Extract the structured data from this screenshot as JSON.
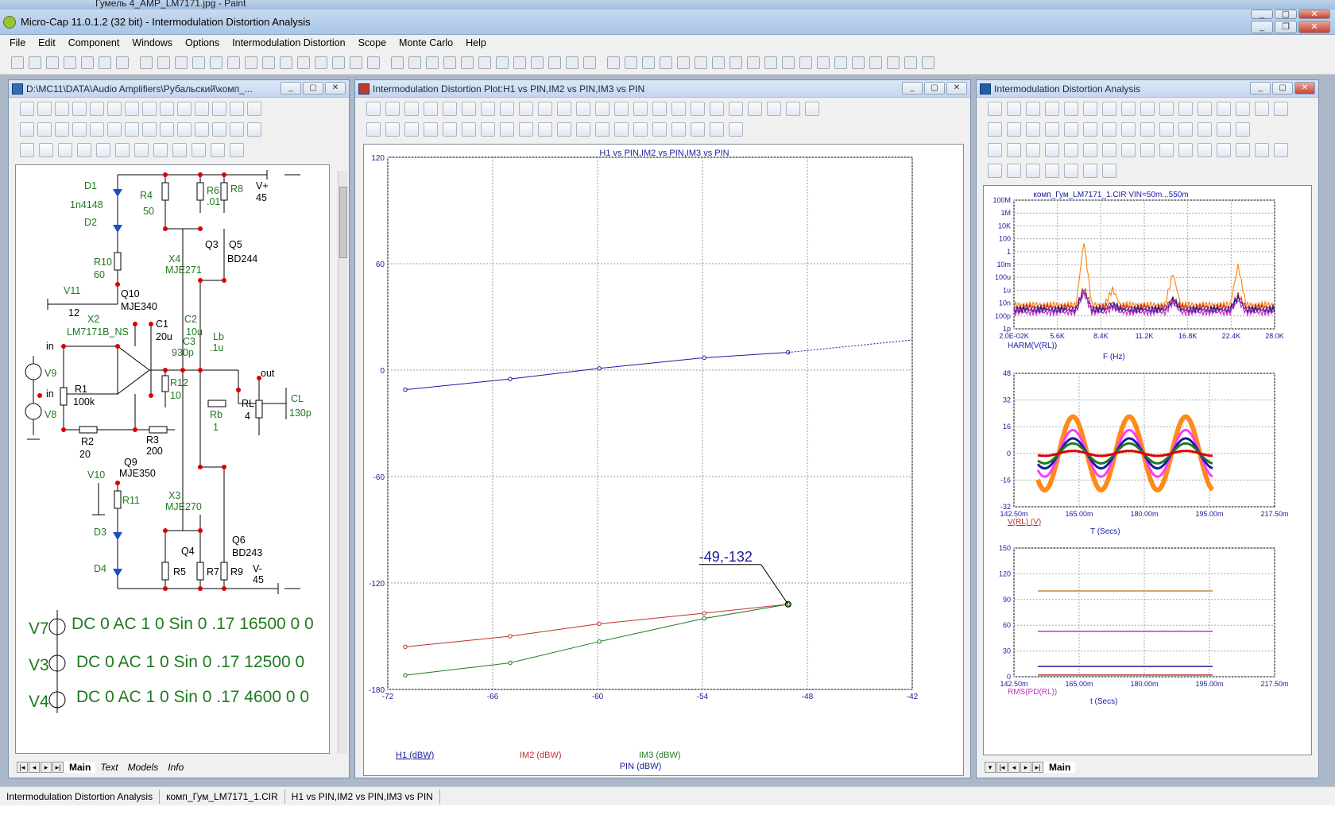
{
  "paint_title": "Гумель 4_AMP_LM7171.jpg - Paint",
  "app_title": "Micro-Cap 11.0.1.2 (32 bit) - Intermodulation Distortion Analysis",
  "menu": [
    "File",
    "Edit",
    "Component",
    "Windows",
    "Options",
    "Intermodulation Distortion",
    "Scope",
    "Monte Carlo",
    "Help"
  ],
  "schematic_window": {
    "title": "D:\\MC11\\DATA\\Audio Amplifiers\\Рубальский\\комп_...",
    "tabs": [
      "Main",
      "Text",
      "Models",
      "Info"
    ],
    "labels": {
      "D1": "D1",
      "n4148": "1n4148",
      "D2": "D2",
      "R4": "R4",
      "R4v": "50",
      "R6": "R6",
      "R6v": ".01",
      "R8": "R8",
      "Vp": "V+",
      "Vpv": "45",
      "R10": "R10",
      "R10v": "60",
      "X4": "X4",
      "X4m": "MJE271",
      "Q3": "Q3",
      "Q5": "Q5",
      "Q5m": "BD244",
      "Q10": "Q10",
      "Q10m": "MJE340",
      "V11": "V11",
      "V11v": "12",
      "X2": "X2",
      "X2m": "LM7171B_NS",
      "C1": "C1",
      "C1v": "20u",
      "C2": "C2",
      "C2v": "10u",
      "C3": "C3",
      "C3v": "930p",
      "Lb": "Lb",
      "Lbv": ".1u",
      "in1": "in",
      "in2": "in",
      "V9": "V9",
      "V8": "V8",
      "R1": "R1",
      "R1v": "100k",
      "R12": "R12",
      "R12v": "10",
      "out": "out",
      "RL": "RL",
      "RLv": "4",
      "Rb": "Rb",
      "Rbv": "1",
      "CL": "CL",
      "CLv": "130p",
      "R2": "R2",
      "R2v": "20",
      "R3": "R3",
      "R3v": "200",
      "Q9": "Q9",
      "Q9m": "MJE350",
      "V10": "V10",
      "R11": "R11",
      "X3": "X3",
      "X3m": "MJE270",
      "D3": "D3",
      "Q6": "Q6",
      "Q6m": "BD243",
      "Q4": "Q4",
      "D4": "D4",
      "R5": "R5",
      "R7": "R7",
      "R9": "R9",
      "Vm": "V-",
      "Vmv": "45"
    },
    "sources": [
      {
        "name": "V7",
        "text": "DC 0 AC 1 0 Sin 0 .17 16500 0 0"
      },
      {
        "name": "V3",
        "text": "DC 0 AC 1 0 Sin 0 .17 12500 0"
      },
      {
        "name": "V4",
        "text": "DC 0 AC 1 0 Sin 0 .17 4600 0 0"
      }
    ]
  },
  "plot_window": {
    "title": "Intermodulation Distortion Plot:H1 vs PIN,IM2 vs PIN,IM3 vs PIN",
    "annotation": "-49,-132",
    "chart_data": {
      "type": "line",
      "title": "H1 vs PIN,IM2 vs PIN,IM3 vs PIN",
      "xlabel": "PIN (dBW)",
      "xlim": [
        -72,
        -42
      ],
      "ylim": [
        -180,
        120
      ],
      "xticks": [
        -72,
        -66,
        -60,
        -54,
        -48,
        -42
      ],
      "yticks": [
        120,
        60,
        0,
        -60,
        -120,
        -180
      ],
      "grid": true,
      "series": [
        {
          "name": "H1 (dBW)",
          "color": "#1a1aa0",
          "x": [
            -71,
            -65,
            -59.9,
            -53.9,
            -49.1
          ],
          "y": [
            -11,
            -5,
            1,
            7,
            10
          ],
          "dashed_extension": {
            "x": [
              -49.1,
              -42
            ],
            "y": [
              10,
              17
            ]
          }
        },
        {
          "name": "IM2 (dBW)",
          "color": "#c0302a",
          "x": [
            -71,
            -65,
            -59.9,
            -53.9,
            -49.1
          ],
          "y": [
            -156,
            -150,
            -143,
            -137,
            -132
          ]
        },
        {
          "name": "IM3 (dBW)",
          "color": "#1f7a1f",
          "x": [
            -71,
            -65,
            -59.9,
            -53.9,
            -49.1
          ],
          "y": [
            -172,
            -165,
            -153,
            -140,
            -132
          ]
        }
      ]
    }
  },
  "analysis_window": {
    "title": "Intermodulation Distortion Analysis",
    "tabs": [
      "Main"
    ],
    "chart_data": [
      {
        "type": "line",
        "title": "комп_Гум_LM7171_1.CIR VIN=50m...550m",
        "ylabel": "HARM(V(RL))",
        "xlabel": "F (Hz)",
        "yticks": [
          "100M",
          "1M",
          "10K",
          "100",
          "1",
          "10m",
          "100u",
          "1u",
          "10n",
          "100p",
          "1p"
        ],
        "xticks": [
          "2.0E-02K",
          "5.6K",
          "8.4K",
          "11.2K",
          "16.8K",
          "22.4K",
          "28.0K"
        ],
        "yscale": "log"
      },
      {
        "type": "line",
        "ylabel": "V(RL) (V)",
        "xlabel": "T (Secs)",
        "ylim": [
          -32,
          48
        ],
        "yticks": [
          48,
          32,
          16,
          0,
          -16,
          -32
        ],
        "xticks": [
          "142.50m",
          "165.00m",
          "180.00m",
          "195.00m",
          "217.50m"
        ]
      },
      {
        "type": "line",
        "ylabel": "RMS(PD(RL))",
        "xlabel": "t (Secs)",
        "ylim": [
          0,
          150
        ],
        "yticks": [
          150,
          120,
          90,
          60,
          30,
          0
        ],
        "xticks": [
          "142.50m",
          "165.00m",
          "180.00m",
          "195.00m",
          "217.50m"
        ],
        "series": [
          {
            "color": "#c08a40",
            "y": 100
          },
          {
            "color": "#c030c0",
            "y": 53
          },
          {
            "color": "#1a1aa0",
            "y": 12
          },
          {
            "color": "#c03030",
            "y": 2
          }
        ]
      }
    ]
  },
  "status": [
    "Intermodulation Distortion Analysis",
    "комп_Гум_LM7171_1.CIR",
    "H1 vs PIN,IM2 vs PIN,IM3 vs PIN"
  ]
}
